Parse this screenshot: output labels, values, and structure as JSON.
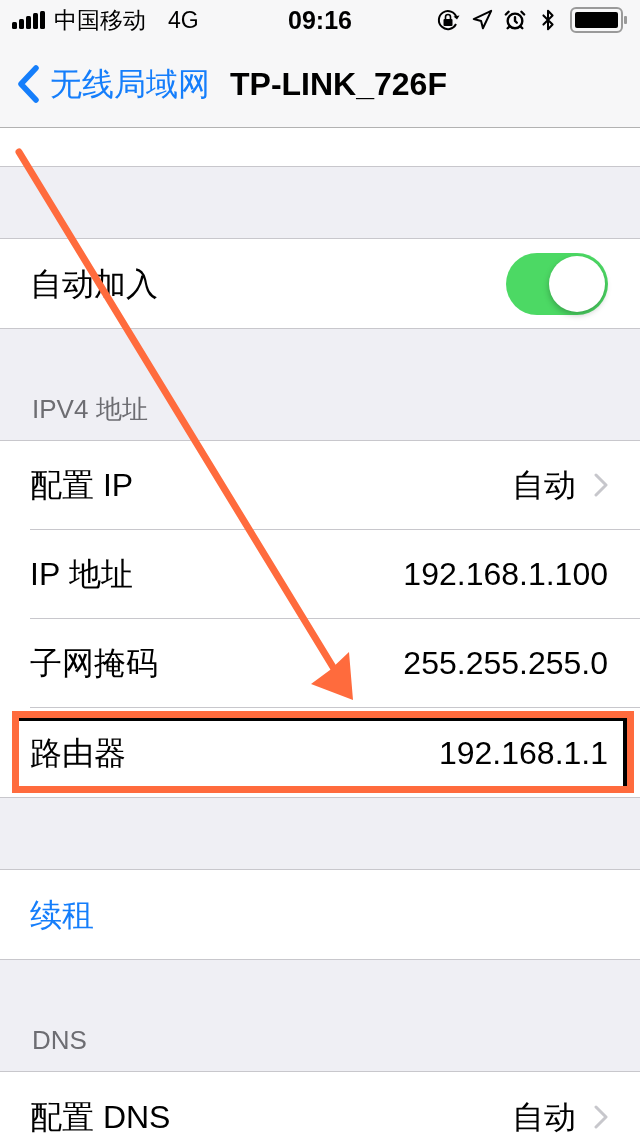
{
  "status_bar": {
    "carrier": "中国移动",
    "network": "4G",
    "time": "09:16"
  },
  "nav_bar": {
    "back_label": "无线局域网",
    "title": "TP-LINK_726F"
  },
  "sections": [
    {
      "rows": [
        {
          "kind": "toggle",
          "label": "自动加入",
          "on": true
        }
      ]
    },
    {
      "header": "IPV4 地址",
      "rows": [
        {
          "kind": "disclosure",
          "label": "配置 IP",
          "value": "自动"
        },
        {
          "kind": "value",
          "label": "IP 地址",
          "value": "192.168.1.100"
        },
        {
          "kind": "value",
          "label": "子网掩码",
          "value": "255.255.255.0"
        },
        {
          "kind": "value",
          "label": "路由器",
          "value": "192.168.1.1",
          "highlighted": true
        }
      ]
    },
    {
      "rows": [
        {
          "kind": "action",
          "label": "续租"
        }
      ]
    },
    {
      "header": "DNS",
      "rows": [
        {
          "kind": "disclosure",
          "label": "配置 DNS",
          "value": "自动"
        }
      ]
    }
  ],
  "annotation_arrow": true
}
